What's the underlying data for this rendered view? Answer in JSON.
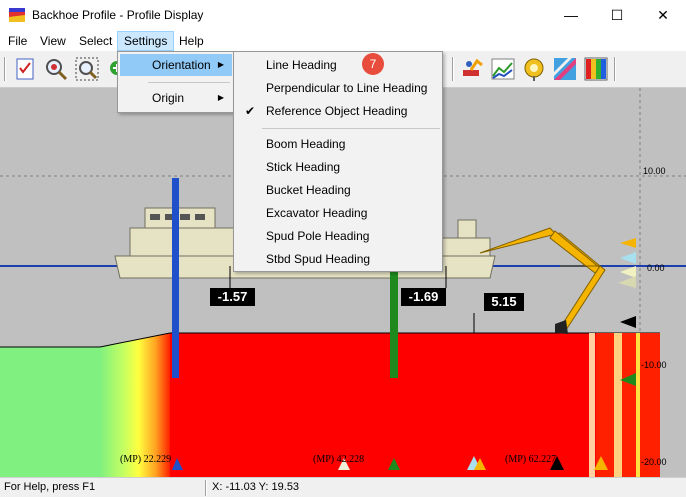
{
  "window": {
    "title": "Backhoe Profile - Profile Display",
    "min": "—",
    "max": "☐",
    "close": "✕"
  },
  "menubar": [
    {
      "label": "File"
    },
    {
      "label": "View"
    },
    {
      "label": "Select"
    },
    {
      "label": "Settings"
    },
    {
      "label": "Help"
    }
  ],
  "settings_menu": {
    "items": [
      {
        "label": "Orientation"
      },
      {
        "label": "Origin"
      }
    ]
  },
  "orientation_menu": {
    "items": [
      {
        "label": "Line Heading"
      },
      {
        "label": "Perpendicular to Line Heading"
      },
      {
        "label": "Reference Object Heading",
        "checked": true
      },
      {
        "label": "Boom Heading"
      },
      {
        "label": "Stick Heading"
      },
      {
        "label": "Bucket Heading"
      },
      {
        "label": "Excavator Heading"
      },
      {
        "label": "Spud Pole Heading"
      },
      {
        "label": "Stbd Spud Heading"
      }
    ],
    "check_glyph": "✔",
    "badge": "7"
  },
  "profile": {
    "depth_labels": [
      "10.00",
      "0.00",
      "-10.00",
      "-20.00"
    ],
    "values": {
      "left_spud": "-1.57",
      "right_spud": "-1.69",
      "bucket": "5.15"
    },
    "mp_labels": [
      "(MP) 22.229",
      "(MP) 42.228",
      "(MP) 62.227"
    ]
  },
  "status": {
    "help": "For Help, press F1",
    "coords": "X: -11.03 Y: 19.53"
  },
  "colors": {
    "accent": "#91c9f7",
    "water": "#1c3fb0",
    "dredge": "#ff0000",
    "spud_left": "#1f4fc9",
    "spud_right": "#1e8a1e",
    "boom": "#f5b400"
  }
}
